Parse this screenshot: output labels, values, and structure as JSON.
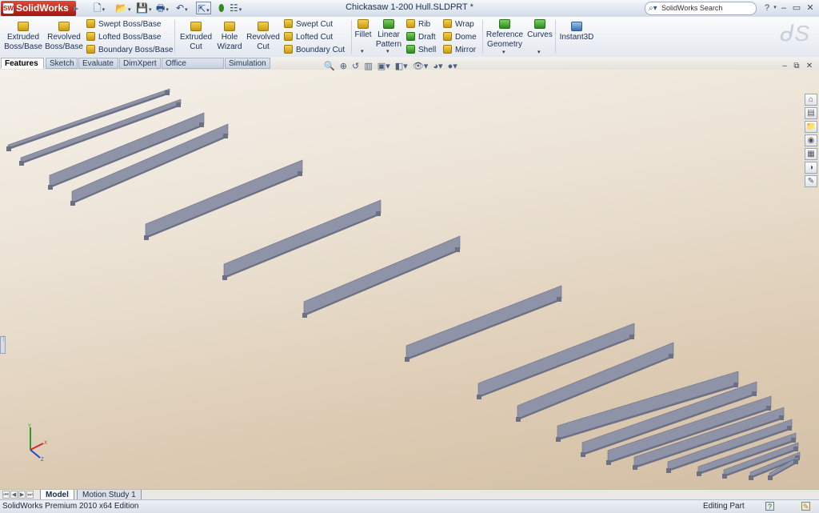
{
  "app": {
    "brand": "SolidWorks",
    "document_title": "Chickasaw 1-200 Hull.SLDPRT *",
    "search_placeholder": "SolidWorks Search"
  },
  "ribbon": {
    "extruded_boss": "Extruded Boss/Base",
    "revolved_boss": "Revolved Boss/Base",
    "swept_boss": "Swept Boss/Base",
    "lofted_boss": "Lofted Boss/Base",
    "boundary_boss": "Boundary Boss/Base",
    "extruded_cut": "Extruded Cut",
    "hole_wizard": "Hole Wizard",
    "revolved_cut": "Revolved Cut",
    "swept_cut": "Swept Cut",
    "lofted_cut": "Lofted Cut",
    "boundary_cut": "Boundary Cut",
    "fillet": "Fillet",
    "linear_pattern": "Linear Pattern",
    "rib": "Rib",
    "draft": "Draft",
    "shell": "Shell",
    "wrap": "Wrap",
    "dome": "Dome",
    "mirror": "Mirror",
    "reference_geometry": "Reference Geometry",
    "curves": "Curves",
    "instant3d": "Instant3D"
  },
  "command_tabs": [
    "Features",
    "Sketch",
    "Evaluate",
    "DimXpert",
    "Office Products",
    "Simulation"
  ],
  "model_tabs": [
    "Model",
    "Motion Study 1"
  ],
  "status": {
    "left": "SolidWorks Premium 2010 x64 Edition",
    "right": "Editing Part"
  },
  "colors": {
    "part_top": "#8e93a8",
    "part_side": "#6b7084",
    "viewport_top": "#f4f0ea",
    "viewport_bottom": "#d2bfa5",
    "brand_red": "#c02015"
  },
  "icons": {
    "search": "magnifier-icon",
    "help": "help-icon",
    "minimize": "minimize-icon",
    "maximize": "maximize-icon",
    "close": "close-icon",
    "triad": "xyz-triad-icon"
  }
}
